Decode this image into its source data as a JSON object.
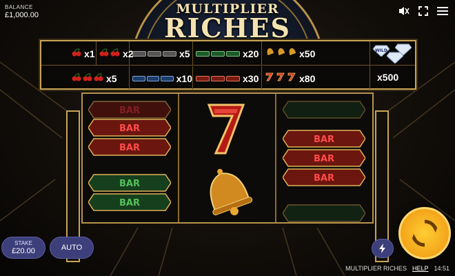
{
  "balance": {
    "label": "BALANCE",
    "value": "£1,000.00"
  },
  "title": {
    "line1": "MULTIPLIER",
    "line2": "RICHES"
  },
  "paytable": {
    "row1": [
      {
        "symbol": "cherry",
        "count": 1,
        "multiplier": "x1"
      },
      {
        "symbol": "cherry",
        "count": 2,
        "multiplier": "x2"
      },
      {
        "symbol": "any-bar",
        "count": 3,
        "multiplier": "x5"
      },
      {
        "symbol": "green-bar",
        "count": 3,
        "multiplier": "x20"
      },
      {
        "symbol": "bell",
        "count": 3,
        "multiplier": "x50"
      }
    ],
    "row2": [
      {
        "symbol": "cherry",
        "count": 3,
        "multiplier": "x5"
      },
      {
        "symbol": "blue-bar",
        "count": 3,
        "multiplier": "x10"
      },
      {
        "symbol": "red-bar",
        "count": 3,
        "multiplier": "x30"
      },
      {
        "symbol": "seven",
        "count": 3,
        "multiplier": "x80"
      }
    ],
    "wild": {
      "label": "WILD",
      "multiplier": "x500"
    }
  },
  "reels": {
    "reel1": [
      "red-bar-partial",
      "red-bar",
      "red-bar",
      "green-bar",
      "green-bar"
    ],
    "reel2": [
      "seven",
      "bell"
    ],
    "reel3": [
      "green-bar-partial",
      "red-bar",
      "red-bar",
      "red-bar",
      "green-bar-partial"
    ],
    "bar_label": "BAR"
  },
  "controls": {
    "stake_label": "STAKE",
    "stake_value": "£20.00",
    "auto_label": "AUTO"
  },
  "footer": {
    "game_name": "MULTIPLIER RICHES",
    "help": "HELP",
    "clock": "14:51"
  },
  "colors": {
    "gold": "#c9a458",
    "button": "#3d3f7a",
    "spin": "#f3a51a",
    "red_bar": "#7a1a12",
    "green_bar": "#1d5a2a"
  }
}
